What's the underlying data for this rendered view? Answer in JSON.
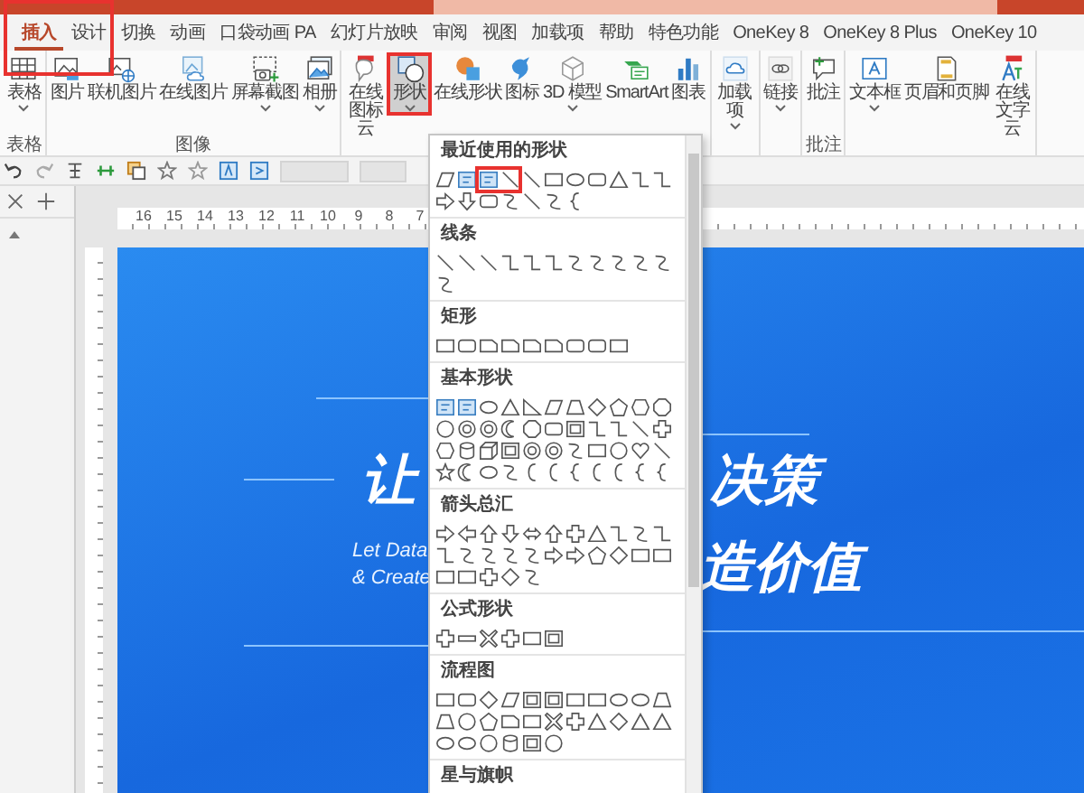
{
  "tabs": [
    {
      "label": "插入",
      "selected": true
    },
    {
      "label": "设计",
      "selected": false
    },
    {
      "label": "切换",
      "selected": false
    },
    {
      "label": "动画",
      "selected": false
    },
    {
      "label": "口袋动画 PA",
      "selected": false
    },
    {
      "label": "幻灯片放映",
      "selected": false
    },
    {
      "label": "审阅",
      "selected": false
    },
    {
      "label": "视图",
      "selected": false
    },
    {
      "label": "加载项",
      "selected": false
    },
    {
      "label": "帮助",
      "selected": false
    },
    {
      "label": "特色功能",
      "selected": false
    },
    {
      "label": "OneKey 8",
      "selected": false
    },
    {
      "label": "OneKey 8 Plus",
      "selected": false
    },
    {
      "label": "OneKey 10",
      "selected": false
    }
  ],
  "ribbon": {
    "groups": [
      {
        "label": "表格",
        "buttons": [
          {
            "kind": "table",
            "label": "表格",
            "dropdown": true,
            "selected": false
          }
        ]
      },
      {
        "label": "图像",
        "buttons": [
          {
            "kind": "picture",
            "label": "图片",
            "dropdown": false,
            "selected": false
          },
          {
            "kind": "online-picture",
            "label": "联机图片",
            "dropdown": false,
            "selected": false
          },
          {
            "kind": "cloud-picture",
            "label": "在线图片",
            "dropdown": false,
            "selected": false
          },
          {
            "kind": "screenshot",
            "label": "屏幕截图",
            "dropdown": true,
            "selected": false
          },
          {
            "kind": "album",
            "label": "相册",
            "dropdown": true,
            "selected": false
          }
        ]
      },
      {
        "buttons": [
          {
            "kind": "icon-cloud",
            "label": "在线图标云",
            "wrap": true,
            "dropdown": false,
            "selected": false
          },
          {
            "kind": "shapes",
            "label": "形状",
            "dropdown": true,
            "selected": true
          },
          {
            "kind": "online-shapes",
            "label": "在线形状",
            "dropdown": false,
            "selected": false
          },
          {
            "kind": "icons",
            "label": "图标",
            "dropdown": false,
            "selected": false
          },
          {
            "kind": "model",
            "label": "3D 模型",
            "dropdown": true,
            "selected": false
          },
          {
            "kind": "smartart",
            "label": "SmartArt",
            "dropdown": false,
            "selected": false
          },
          {
            "kind": "chart",
            "label": "图表",
            "dropdown": false,
            "selected": false
          }
        ]
      },
      {
        "buttons": [
          {
            "kind": "addins",
            "label": "加载项",
            "wrap": true,
            "dropdown": true,
            "selected": false
          }
        ]
      },
      {
        "buttons": [
          {
            "kind": "link",
            "label": "链接",
            "dropdown": true,
            "selected": false
          }
        ]
      },
      {
        "label": "批注",
        "buttons": [
          {
            "kind": "comment",
            "label": "批注",
            "dropdown": false,
            "selected": false
          }
        ]
      },
      {
        "buttons": [
          {
            "kind": "textbox",
            "label": "文本框",
            "dropdown": true,
            "selected": false
          },
          {
            "kind": "header-footer",
            "label": "页眉和页脚",
            "dropdown": false,
            "selected": false
          },
          {
            "kind": "word-cloud",
            "label": "在线文字云",
            "wrap": true,
            "dropdown": false,
            "selected": false
          }
        ]
      }
    ]
  },
  "ruler": {
    "numbers": [
      "16",
      "15",
      "14",
      "13",
      "12",
      "11",
      "10",
      "9",
      "8",
      "7"
    ]
  },
  "slide": {
    "title_parts": [
      "让",
      "决策",
      "造价值"
    ],
    "subtitle_lines": [
      "Let Data",
      "& Create"
    ]
  },
  "shapes_menu": {
    "sections": [
      {
        "title": "最近使用的形状"
      },
      {
        "title": "线条"
      },
      {
        "title": "矩形"
      },
      {
        "title": "基本形状"
      },
      {
        "title": "箭头总汇"
      },
      {
        "title": "公式形状"
      },
      {
        "title": "流程图"
      },
      {
        "title": "星与旗帜"
      }
    ]
  }
}
